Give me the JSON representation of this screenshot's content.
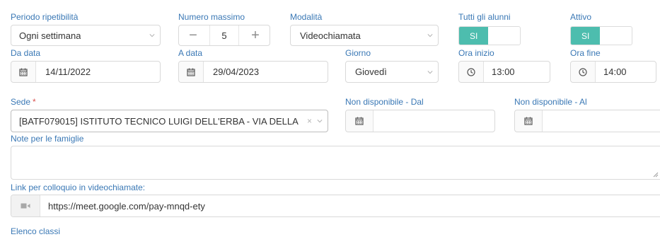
{
  "row1": {
    "periodo_label": "Periodo ripetibilità",
    "periodo_value": "Ogni settimana",
    "numero_label": "Numero massimo",
    "numero_value": "5",
    "minus": "−",
    "plus": "+",
    "modalita_label": "Modalità",
    "modalita_value": "Videochiamata",
    "tutti_label": "Tutti gli alunni",
    "tutti_toggle": "SI",
    "attivo_label": "Attivo",
    "attivo_toggle": "SI"
  },
  "row2": {
    "da_data_label": "Da data",
    "da_data_value": "14/11/2022",
    "a_data_label": "A data",
    "a_data_value": "29/04/2023",
    "giorno_label": "Giorno",
    "giorno_value": "Giovedì",
    "ora_inizio_label": "Ora inizio",
    "ora_inizio_value": "13:00",
    "ora_fine_label": "Ora fine",
    "ora_fine_value": "14:00"
  },
  "row3": {
    "sede_label": "Sede",
    "sede_required": "*",
    "sede_value": "[BATF079015] ISTITUTO TECNICO LUIGI DELL'ERBA - VIA DELLA ...",
    "sede_clear": "×",
    "nd_dal_label": "Non disponibile - Dal",
    "nd_dal_value": "",
    "nd_al_label": "Non disponibile - Al",
    "nd_al_value": ""
  },
  "note": {
    "label": "Note per le famiglie",
    "value": ""
  },
  "link": {
    "label": "Link per colloquio in videochiamate:",
    "value": "https://meet.google.com/pay-mnqd-ety"
  },
  "classi": {
    "label": "Elenco classi"
  },
  "icons": {
    "calendar": "calendar-icon",
    "clock": "clock-icon",
    "video": "video-camera-icon",
    "chevron": "chevron-down-icon"
  },
  "colors": {
    "label": "#3a78b5",
    "toggle_on": "#4dbdae",
    "required": "#d9534f",
    "border": "#d9d9d9"
  }
}
